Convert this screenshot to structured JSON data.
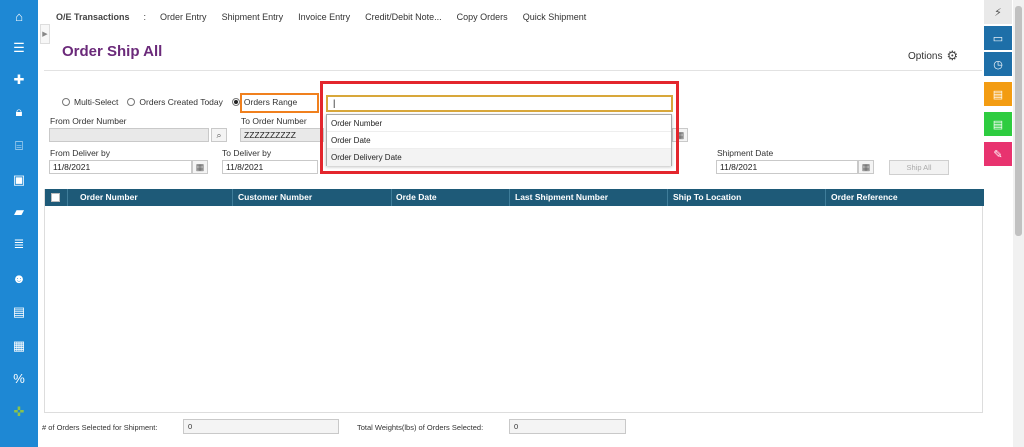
{
  "nav_icons": [
    "home-icon",
    "upload-list-icon",
    "add-list-icon",
    "lock-icon",
    "bank-icon",
    "briefcase-icon",
    "folder-icon",
    "layers-icon",
    "users-icon",
    "book-icon",
    "table-icon",
    "percent-icon",
    "puzzle-icon"
  ],
  "top_menu": {
    "title": "O/E Transactions",
    "separator": ":",
    "items": [
      "Order Entry",
      "Shipment Entry",
      "Invoice Entry",
      "Credit/Debit Note...",
      "Copy Orders",
      "Quick Shipment"
    ]
  },
  "page_title": "Order Ship All",
  "options_label": "Options",
  "radios": [
    {
      "label": "Multi-Select",
      "checked": false
    },
    {
      "label": "Orders Created Today",
      "checked": false
    },
    {
      "label": "Orders Range",
      "checked": true
    }
  ],
  "fields": {
    "from_order_number": {
      "label": "From Order Number",
      "value": ""
    },
    "to_order_number": {
      "label": "To Order Number",
      "value": "ZZZZZZZZZZ"
    },
    "from_deliver_by": {
      "label": "From Deliver by",
      "value": "11/8/2021"
    },
    "to_deliver_by": {
      "label": "To Deliver by",
      "value": "11/8/2021"
    },
    "shipment_date": {
      "label": "Shipment Date",
      "value": "11/8/2021"
    }
  },
  "ship_all_label": "Ship All",
  "dropdown": {
    "input_value": "|",
    "options": [
      "Order Number",
      "Order Date",
      "Order Delivery Date"
    ]
  },
  "grid": {
    "columns": [
      "Order Number",
      "Customer Number",
      "Orde Date",
      "Last Shipment Number",
      "Ship To Location",
      "Order Reference"
    ],
    "rows": []
  },
  "footer": {
    "orders_selected_label": "# of Orders Selected for Shipment:",
    "orders_selected_value": "0",
    "total_weights_label": "Total Weights(lbs) of Orders Selected:",
    "total_weights_value": "0"
  },
  "right_dock": [
    {
      "icon": "lightning-icon",
      "color": "#e9e9e9"
    },
    {
      "icon": "window-1-icon",
      "color": "#1e6fa8"
    },
    {
      "icon": "window-clock-icon",
      "color": "#1e6fa8"
    },
    {
      "icon": "document-orange-icon",
      "color": "#f39c12"
    },
    {
      "icon": "document-green-icon",
      "color": "#2ecc40"
    },
    {
      "icon": "pen-icon",
      "color": "#e8336f"
    }
  ]
}
